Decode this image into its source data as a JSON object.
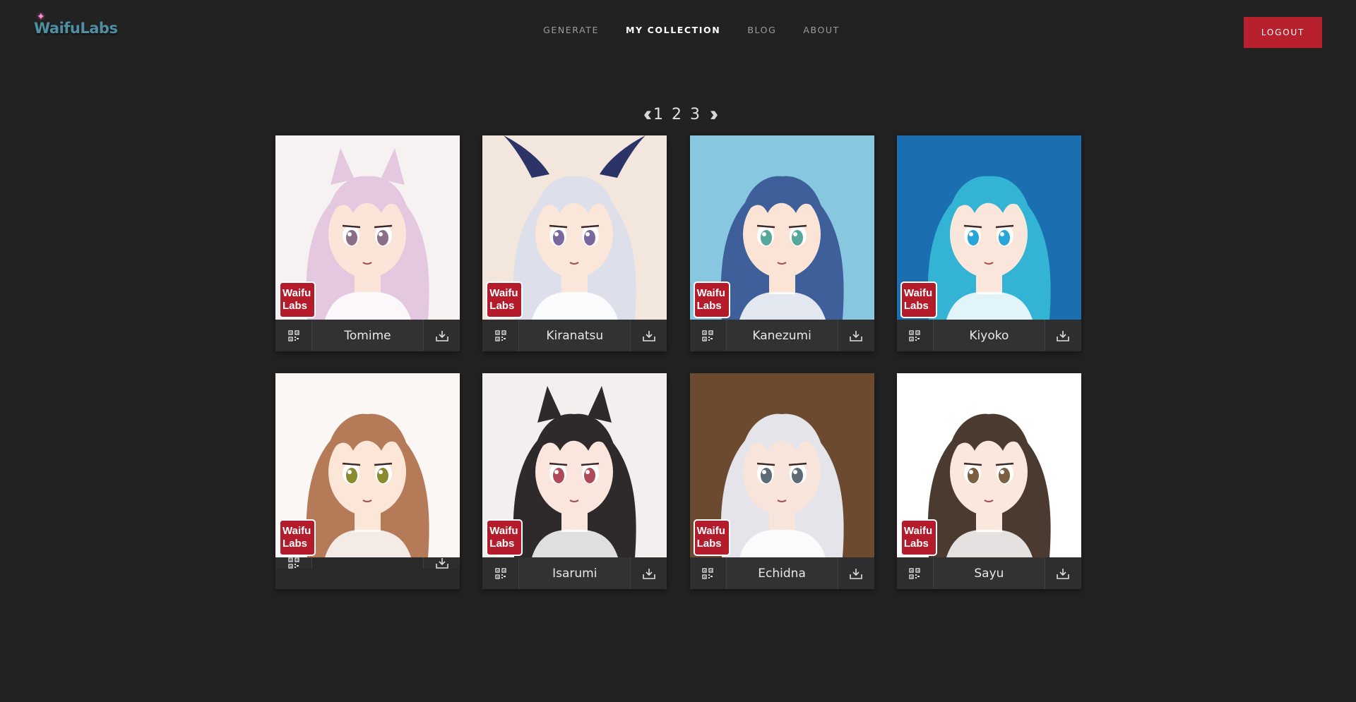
{
  "app": {
    "logo": "WaifuLabs"
  },
  "nav": {
    "items": [
      {
        "label": "GENERATE",
        "active": false
      },
      {
        "label": "MY COLLECTION",
        "active": true
      },
      {
        "label": "BLOG",
        "active": false
      },
      {
        "label": "ABOUT",
        "active": false
      }
    ],
    "logout_label": "LOGOUT"
  },
  "pagination": {
    "prev_icon": "double-chevron-left-icon",
    "pages": [
      "1",
      "2",
      "3"
    ],
    "next_icon": "double-chevron-right-icon"
  },
  "watermark": {
    "line1": "Waifu",
    "line2": "Labs"
  },
  "cards": [
    {
      "name": "Tomime",
      "hair": "#e3c8df",
      "bg": "#f7f2f2",
      "eyes": "#8a6f86",
      "skin": "#fbe4d8",
      "ears": true
    },
    {
      "name": "Kiranatsu",
      "hair": "#dde0ea",
      "bg": "#f3e6dc",
      "eyes": "#7a67a0",
      "skin": "#fbe6da",
      "horns": true
    },
    {
      "name": "Kanezumi",
      "hair": "#3e5f9a",
      "bg": "#87c8e0",
      "eyes": "#56a89a",
      "skin": "#fbe4d6"
    },
    {
      "name": "Kiyoko",
      "hair": "#34b4d4",
      "bg": "#1b6fb0",
      "eyes": "#27a5d8",
      "skin": "#fbe6dc"
    },
    {
      "name": "",
      "hair": "#b57a58",
      "bg": "#fbf7f4",
      "eyes": "#8a8a30",
      "skin": "#fbe6d8",
      "broken": true
    },
    {
      "name": "Isarumi",
      "hair": "#2e2a2c",
      "bg": "#f2efee",
      "eyes": "#b04a5a",
      "skin": "#fbe6de",
      "ears": true
    },
    {
      "name": "Echidna",
      "hair": "#e4e4ea",
      "bg": "#6b4a30",
      "eyes": "#5d6c74",
      "skin": "#f7e4da"
    },
    {
      "name": "Sayu",
      "hair": "#4a3a30",
      "bg": "#ffffff",
      "eyes": "#7a6040",
      "skin": "#fbe7dc"
    }
  ],
  "icons": {
    "qr": "qr-code-icon",
    "download": "download-icon"
  }
}
